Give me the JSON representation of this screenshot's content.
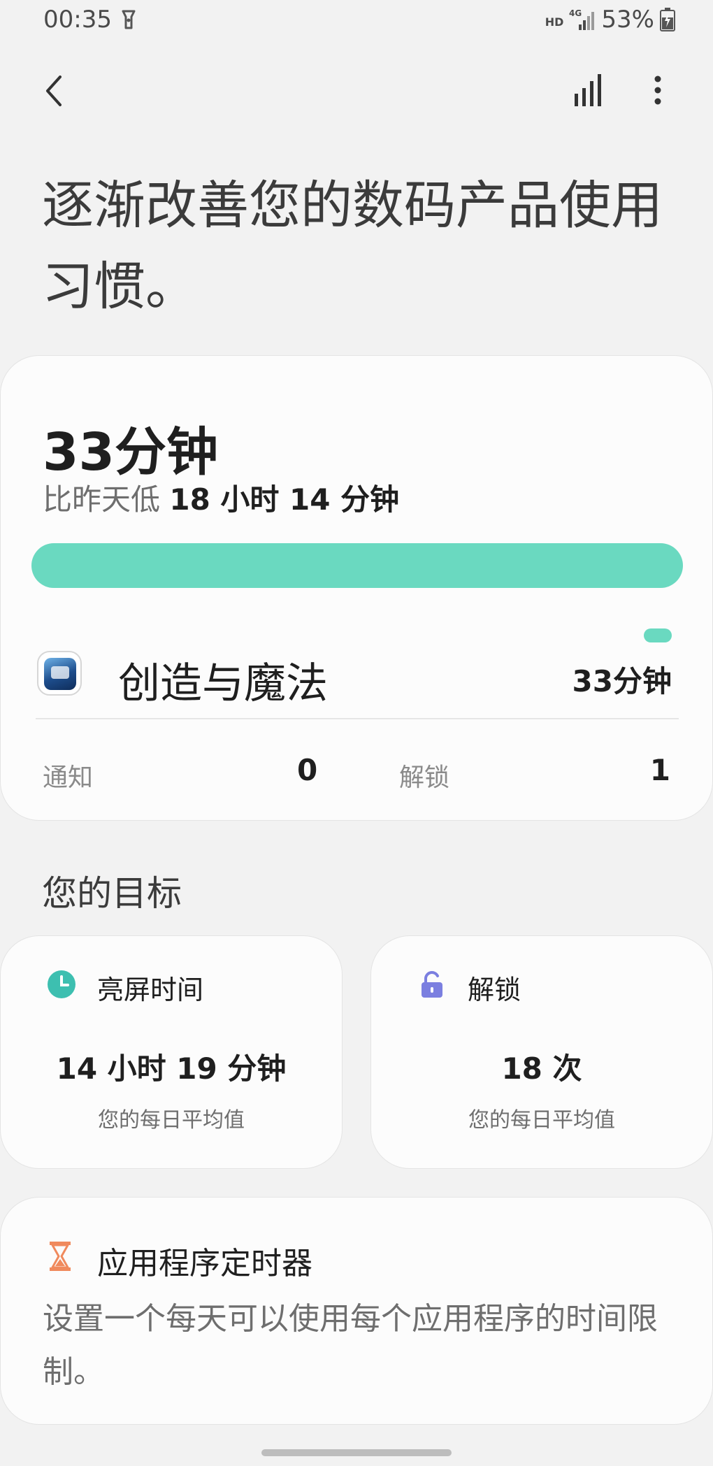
{
  "status_bar": {
    "time": "00:35",
    "network_label": "HD",
    "network_type": "4G",
    "battery": "53%"
  },
  "toolbar": {
    "back_icon": "chevron-left-icon",
    "stats_icon": "bar-chart-icon",
    "more_icon": "more-vert-icon"
  },
  "page": {
    "title": "逐渐改善您的数码产品使用习惯。"
  },
  "summary": {
    "total_time": "33分钟",
    "compare_prefix": "比昨天低 ",
    "compare_value": "18 小时 14 分钟",
    "usage_fraction": 1.0,
    "accent_color": "#6ad9c0",
    "app": {
      "name": "创造与魔法",
      "time": "33分钟"
    },
    "notifications_label": "通知",
    "notifications_value": "0",
    "unlocks_label": "解锁",
    "unlocks_value": "1"
  },
  "goals": {
    "title": "您的目标",
    "screen_time": {
      "icon": "clock-icon",
      "icon_color": "#3dbfb0",
      "label": "亮屏时间",
      "value": "14 小时 19 分钟",
      "subtitle": "您的每日平均值"
    },
    "unlocks": {
      "icon": "unlock-icon",
      "icon_color": "#7b7fe0",
      "label": "解锁",
      "value": "18 次",
      "subtitle": "您的每日平均值"
    }
  },
  "app_timer": {
    "icon": "hourglass-icon",
    "icon_color": "#f08a5d",
    "title": "应用程序定时器",
    "description": "设置一个每天可以使用每个应用程序的时间限制。"
  }
}
